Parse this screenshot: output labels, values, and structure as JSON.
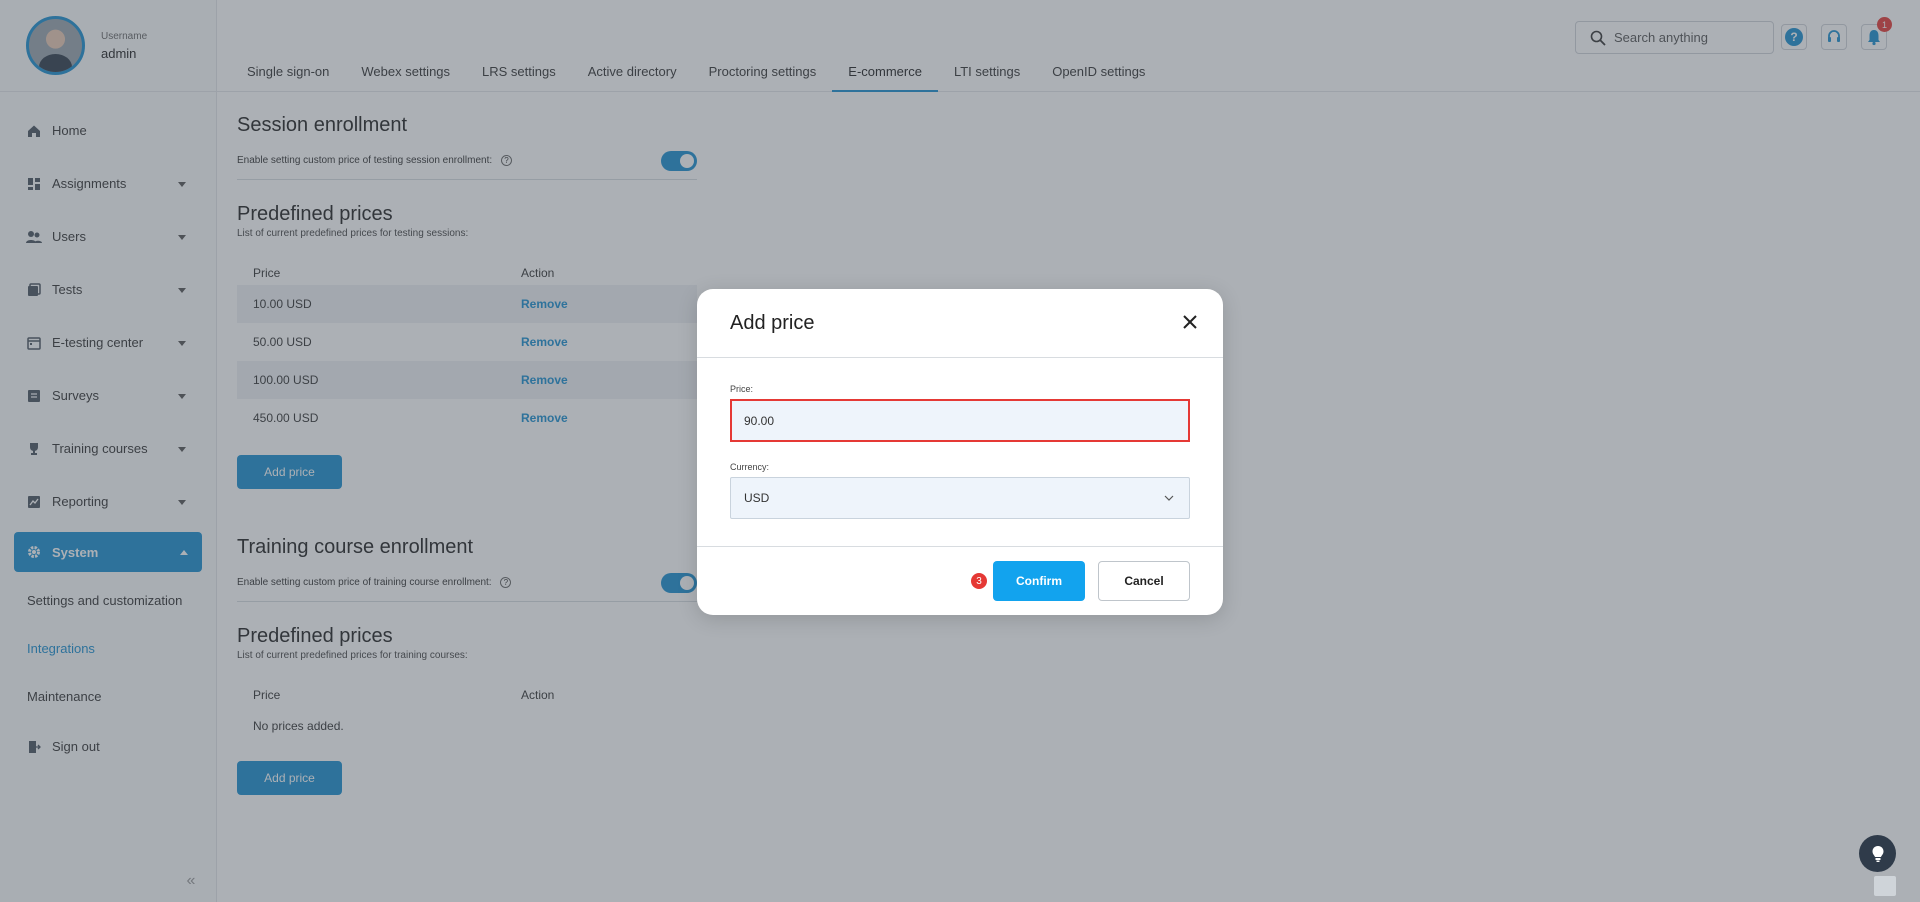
{
  "profile": {
    "label": "Username",
    "name": "admin"
  },
  "sidebar": {
    "items": [
      {
        "label": "Home",
        "icon": "home-icon"
      },
      {
        "label": "Assignments",
        "icon": "dashboard-icon"
      },
      {
        "label": "Users",
        "icon": "users-icon"
      },
      {
        "label": "Tests",
        "icon": "tests-icon"
      },
      {
        "label": "E-testing center",
        "icon": "calendar-icon"
      },
      {
        "label": "Surveys",
        "icon": "list-icon"
      },
      {
        "label": "Training courses",
        "icon": "trophy-icon"
      },
      {
        "label": "Reporting",
        "icon": "report-icon"
      },
      {
        "label": "System",
        "icon": "gear-icon"
      }
    ],
    "subitems": [
      "Settings and customization",
      "Integrations",
      "Maintenance"
    ],
    "signout": "Sign out"
  },
  "header": {
    "search_placeholder": "Search anything",
    "help": "?",
    "notifications": "1"
  },
  "tabs": [
    "Single sign-on",
    "Webex settings",
    "LRS settings",
    "Active directory",
    "Proctoring settings",
    "E-commerce",
    "LTI settings",
    "OpenID settings"
  ],
  "session": {
    "title": "Session enrollment",
    "toggle_label": "Enable setting custom price of testing session enrollment:",
    "prices_title": "Predefined prices",
    "prices_caption": "List of current predefined prices for testing sessions:",
    "col_price": "Price",
    "col_action": "Action",
    "rows": [
      {
        "price": "10.00 USD",
        "action": "Remove"
      },
      {
        "price": "50.00 USD",
        "action": "Remove"
      },
      {
        "price": "100.00 USD",
        "action": "Remove"
      },
      {
        "price": "450.00 USD",
        "action": "Remove"
      }
    ],
    "add_btn": "Add price"
  },
  "training": {
    "title": "Training course enrollment",
    "toggle_label": "Enable setting custom price of training course enrollment:",
    "prices_title": "Predefined prices",
    "prices_caption": "List of current predefined prices for training courses:",
    "col_price": "Price",
    "col_action": "Action",
    "empty": "No prices added.",
    "add_btn": "Add price"
  },
  "modal": {
    "title": "Add price",
    "price_label": "Price:",
    "price_value": "90.00",
    "currency_label": "Currency:",
    "currency_value": "USD",
    "step": "3",
    "confirm": "Confirm",
    "cancel": "Cancel"
  },
  "colors": {
    "accent": "#1a8fd0",
    "confirm": "#12a3ee",
    "highlight": "#e53935"
  }
}
